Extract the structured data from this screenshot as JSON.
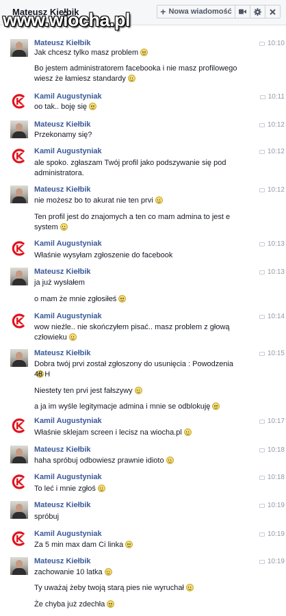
{
  "header": {
    "title": "Mateusz Kiełbik",
    "new_message_label": "Nowa wiadomość",
    "video_icon": "video-camera-icon",
    "settings_icon": "gear-icon",
    "close_icon": "close-icon"
  },
  "watermark": "www.wiocha.pl",
  "colors": {
    "name": "#3b5998",
    "time": "#9197a3",
    "text": "#141823",
    "header_bg": "#f6f7f9"
  },
  "messages": [
    {
      "sender": "Mateusz Kiełbik",
      "time": "10:10",
      "avatar": "mateusz-avatar",
      "lines": [
        "Jak chcesz tylko masz problem",
        "Bo jestem administratorem facebooka i nie masz profilowego",
        "wiesz że łamiesz standardy"
      ]
    },
    {
      "sender": "Kamil Augustyniak",
      "time": "10:11",
      "avatar": "kamil-avatar",
      "lines": [
        "oo tak.. boję się"
      ]
    },
    {
      "sender": "Mateusz Kiełbik",
      "time": "10:12",
      "avatar": "mateusz-avatar",
      "lines": [
        "Przekonamy się?"
      ]
    },
    {
      "sender": "Kamil Augustyniak",
      "time": "10:12",
      "avatar": "kamil-avatar",
      "lines": [
        "ale spoko. zgłaszam Twój profil jako podszywanie się pod",
        "administratora."
      ]
    },
    {
      "sender": "Mateusz Kiełbik",
      "time": "10:12",
      "avatar": "mateusz-avatar",
      "lines": [
        "nie możesz bo to akurat nie ten prvi",
        "Ten profil jest do znajomych a ten co mam admina to jest e",
        "system"
      ]
    },
    {
      "sender": "Kamil Augustyniak",
      "time": "10:13",
      "avatar": "kamil-avatar",
      "lines": [
        "Właśnie wysyłam zgłoszenie do facebook"
      ]
    },
    {
      "sender": "Mateusz Kiełbik",
      "time": "10:13",
      "avatar": "mateusz-avatar",
      "lines": [
        "ja już wysłałem",
        "o mam że mnie zgłosiłeś"
      ]
    },
    {
      "sender": "Kamil Augustyniak",
      "time": "10:14",
      "avatar": "kamil-avatar",
      "lines": [
        "wow nieźle.. nie skończyłem pisać.. masz problem z głową",
        "człowieku"
      ]
    },
    {
      "sender": "Mateusz Kiełbik",
      "time": "10:15",
      "avatar": "mateusz-avatar",
      "lines": [
        "Dobra twój prvi został zgłoszony do usunięcia : Powodzenia",
        "48 H",
        "Niestety ten prvi jest fałszywy",
        "a ja im wyśle legitymacje admina i mnie se odblokuję"
      ]
    },
    {
      "sender": "Kamil Augustyniak",
      "time": "10:17",
      "avatar": "kamil-avatar",
      "lines": [
        "Właśnie sklejam screen i lecisz na wiocha.pl"
      ]
    },
    {
      "sender": "Mateusz Kiełbik",
      "time": "10:18",
      "avatar": "mateusz-avatar",
      "lines": [
        "haha spróbuj odbowiesz prawnie idioto"
      ]
    },
    {
      "sender": "Kamil Augustyniak",
      "time": "10:18",
      "avatar": "kamil-avatar",
      "lines": [
        "To leć i mnie zgłoś"
      ]
    },
    {
      "sender": "Mateusz Kiełbik",
      "time": "10:19",
      "avatar": "mateusz-avatar",
      "lines": [
        "spróbuj"
      ]
    },
    {
      "sender": "Kamil Augustyniak",
      "time": "10:19",
      "avatar": "kamil-avatar",
      "lines": [
        "Za 5 min max dam Ci linka"
      ]
    },
    {
      "sender": "Mateusz Kiełbik",
      "time": "10:19",
      "avatar": "mateusz-avatar",
      "lines": [
        "zachowanie 10 latka",
        "Ty uważaj żeby twoją starą pies nie wyruchał",
        "Że chyba już zdechła"
      ]
    }
  ]
}
